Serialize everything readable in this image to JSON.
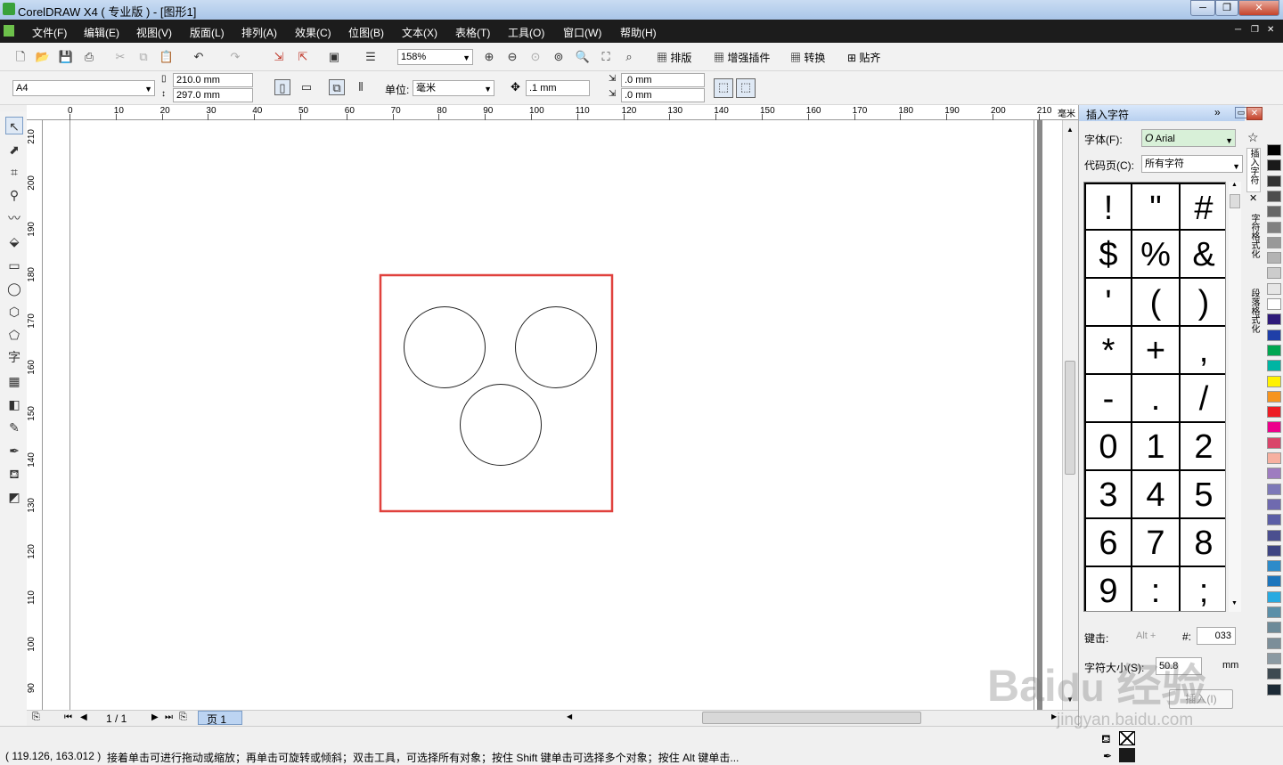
{
  "window": {
    "title": "CorelDRAW X4 ( 专业版 ) - [图形1]"
  },
  "menu": [
    "文件(F)",
    "编辑(E)",
    "视图(V)",
    "版面(L)",
    "排列(A)",
    "效果(C)",
    "位图(B)",
    "文本(X)",
    "表格(T)",
    "工具(O)",
    "窗口(W)",
    "帮助(H)"
  ],
  "toolbar1": {
    "zoom": "158%",
    "buttons": [
      "排版",
      "增强插件",
      "转换",
      "贴齐"
    ]
  },
  "toolbar2": {
    "page_size": "A4",
    "width": "210.0 mm",
    "height": "297.0 mm",
    "unit_label": "单位:",
    "unit": "毫米",
    "nudge": ".1 mm",
    "dup_x": ".0 mm",
    "dup_y": ".0 mm"
  },
  "ruler_top": [
    "0",
    "10",
    "20",
    "30",
    "40",
    "50",
    "60",
    "70",
    "80",
    "90",
    "100",
    "110",
    "120",
    "130",
    "140",
    "150",
    "160",
    "170",
    "180",
    "190",
    "200",
    "210",
    "毫米"
  ],
  "ruler_left": [
    "210",
    "200",
    "190",
    "180",
    "170",
    "160",
    "150",
    "140",
    "130",
    "120",
    "110",
    "100",
    "90"
  ],
  "pager": {
    "count": "1 / 1",
    "tab": "页 1"
  },
  "status": {
    "coords": "( 119.126, 163.012 )",
    "message": "接着单击可进行拖动或缩放；再单击可旋转或倾斜；双击工具，可选择所有对象；按住 Shift 键单击可选择多个对象；按住 Alt 键单击..."
  },
  "docker": {
    "title": "插入字符",
    "font_label": "字体(F):",
    "font_value": "Arial",
    "codepage_label": "代码页(C):",
    "codepage_value": "所有字符",
    "chars": [
      "!",
      "\"",
      "#",
      "$",
      "%",
      "&",
      "'",
      "(",
      ")",
      "*",
      "+",
      ",",
      "-",
      ".",
      "/",
      "0",
      "1",
      "2",
      "3",
      "4",
      "5",
      "6",
      "7",
      "8",
      "9",
      ":",
      ";"
    ],
    "keystroke_label": "键击:",
    "alt_label": "Alt +",
    "hash_label": "#:",
    "hash_value": "033",
    "size_label": "字符大小(S):",
    "size_value": "50.8",
    "size_unit": "mm",
    "insert_button": "插入(I)",
    "side_tabs": [
      "插入字符",
      "字符格式化",
      "段落格式化"
    ]
  },
  "watermark": {
    "logo": "Baidu 经验",
    "url": "jingyan.baidu.com"
  },
  "palette_colors": [
    "#000000",
    "#1a1a1a",
    "#333333",
    "#4d4d4d",
    "#666666",
    "#808080",
    "#999999",
    "#b3b3b3",
    "#cccccc",
    "#e6e6e6",
    "#ffffff",
    "#2e1a7a",
    "#1f3fa8",
    "#00a650",
    "#00b5a3",
    "#fff200",
    "#f7941d",
    "#ed1c24",
    "#ec008c",
    "#d9456a",
    "#f7b0a0",
    "#9e7cc0",
    "#7d79b8",
    "#6f6aaf",
    "#5b5ea6",
    "#4b4f8f",
    "#3d4482",
    "#2e8bc9",
    "#1c75bc",
    "#27aae1",
    "#5b8fa8",
    "#6c8a99",
    "#7c8e99",
    "#8b9aa3",
    "#3e4a52",
    "#1c2a36"
  ]
}
